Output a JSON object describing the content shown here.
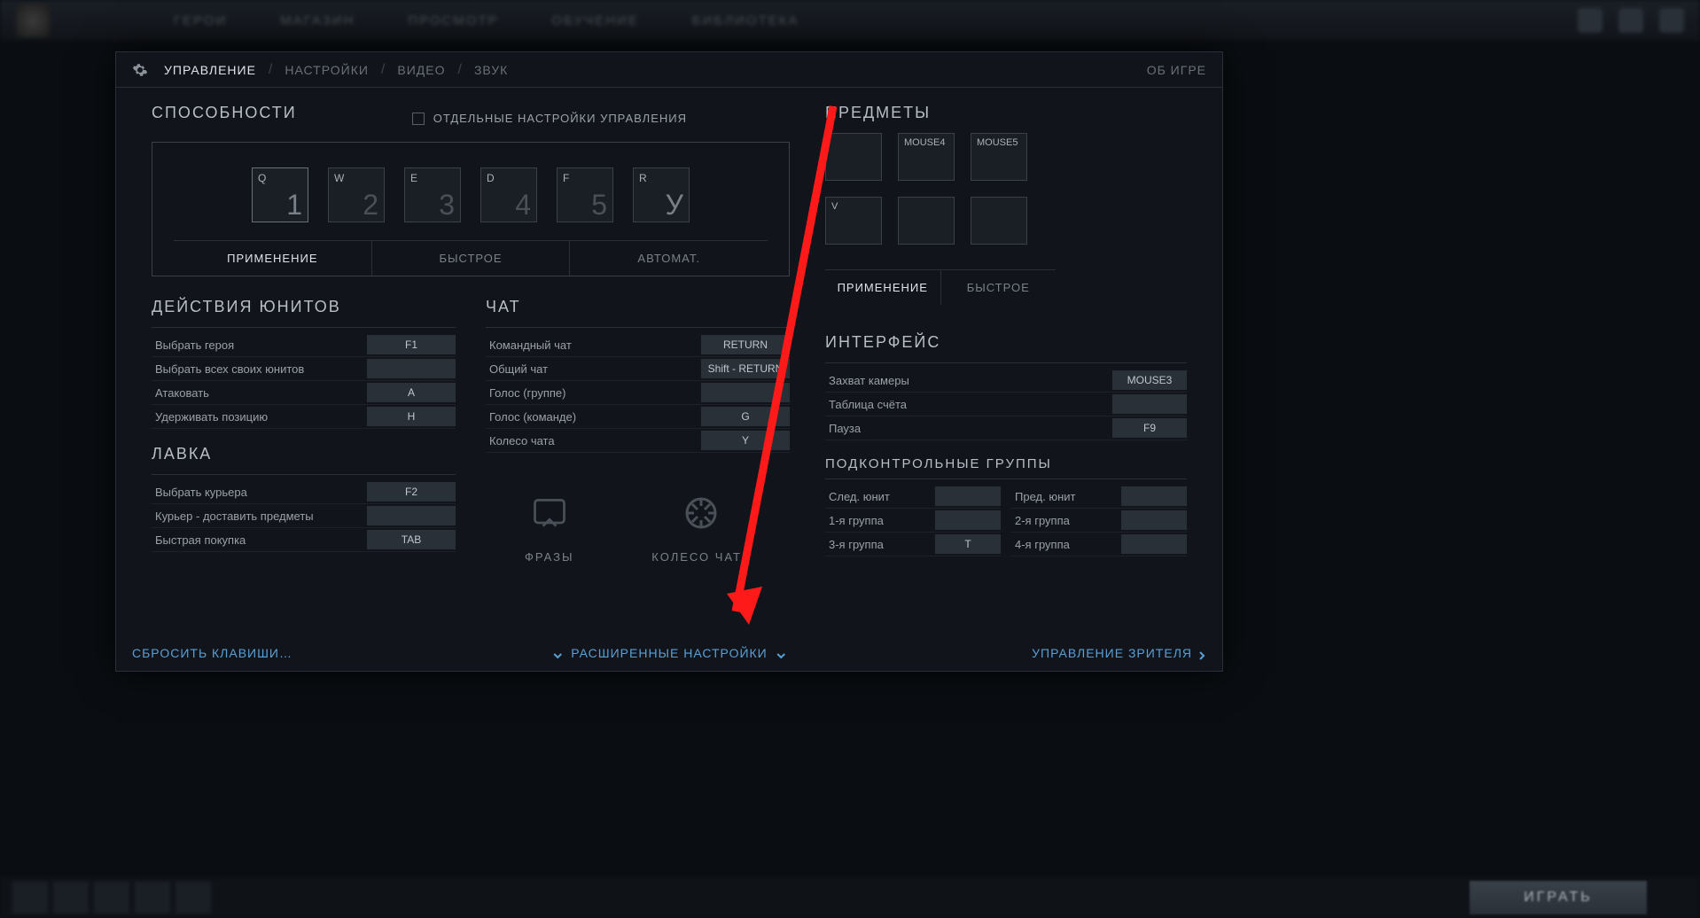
{
  "topnav": {
    "items": [
      "ГЕРОИ",
      "МАГАЗИН",
      "ПРОСМОТР",
      "ОБУЧЕНИЕ",
      "БИБЛИОТЕКА"
    ]
  },
  "tabs": {
    "controls": "УПРАВЛЕНИЕ",
    "settings": "НАСТРОЙКИ",
    "video": "ВИДЕО",
    "audio": "ЗВУК",
    "about": "ОБ ИГРЕ"
  },
  "abilities": {
    "title": "СПОСОБНОСТИ",
    "advanced_hotkeys": "ОТДЕЛЬНЫЕ НАСТРОЙКИ УПРАВЛЕНИЯ",
    "slots": [
      {
        "key": "Q",
        "num": "1"
      },
      {
        "key": "W",
        "num": "2"
      },
      {
        "key": "E",
        "num": "3"
      },
      {
        "key": "D",
        "num": "4"
      },
      {
        "key": "F",
        "num": "5"
      },
      {
        "key": "R",
        "num": "У"
      }
    ],
    "mode_cast": "ПРИМЕНЕНИЕ",
    "mode_quick": "БЫСТРОЕ",
    "mode_auto": "АВТОМАТ."
  },
  "unit_actions": {
    "title": "ДЕЙСТВИЯ ЮНИТОВ",
    "rows": [
      {
        "label": "Выбрать героя",
        "key": "F1"
      },
      {
        "label": "Выбрать всех своих юнитов",
        "key": ""
      },
      {
        "label": "Атаковать",
        "key": "A"
      },
      {
        "label": "Удерживать позицию",
        "key": "H"
      }
    ]
  },
  "shop": {
    "title": "ЛАВКА",
    "rows": [
      {
        "label": "Выбрать курьера",
        "key": "F2"
      },
      {
        "label": "Курьер - доставить предметы",
        "key": ""
      },
      {
        "label": "Быстрая покупка",
        "key": "TAB"
      }
    ]
  },
  "chat": {
    "title": "ЧАТ",
    "rows": [
      {
        "label": "Командный чат",
        "key": "RETURN"
      },
      {
        "label": "Общий чат",
        "key": "Shift - RETURN"
      },
      {
        "label": "Голос (группе)",
        "key": ""
      },
      {
        "label": "Голос (команде)",
        "key": "G"
      },
      {
        "label": "Колесо чата",
        "key": "Y"
      }
    ],
    "phrases": "ФРАЗЫ",
    "wheel": "КОЛЕСО ЧАТА"
  },
  "items": {
    "title": "ПРЕДМЕТЫ",
    "slots": [
      {
        "key": ""
      },
      {
        "key": "MOUSE4"
      },
      {
        "key": "MOUSE5"
      },
      {
        "key": "V"
      },
      {
        "key": ""
      },
      {
        "key": ""
      }
    ],
    "mode_cast": "ПРИМЕНЕНИЕ",
    "mode_quick": "БЫСТРОЕ"
  },
  "interface": {
    "title": "ИНТЕРФЕЙС",
    "rows": [
      {
        "label": "Захват камеры",
        "key": "MOUSE3"
      },
      {
        "label": "Таблица счёта",
        "key": ""
      },
      {
        "label": "Пауза",
        "key": "F9"
      }
    ]
  },
  "control_groups": {
    "title": "ПОДКОНТРОЛЬНЫЕ ГРУППЫ",
    "next": {
      "label": "След. юнит",
      "key": ""
    },
    "prev": {
      "label": "Пред. юнит",
      "key": ""
    },
    "g1": {
      "label": "1-я группа",
      "key": ""
    },
    "g2": {
      "label": "2-я группа",
      "key": ""
    },
    "g3": {
      "label": "3-я группа",
      "key": "T"
    },
    "g4": {
      "label": "4-я группа",
      "key": ""
    }
  },
  "footer": {
    "reset": "СБРОСИТЬ КЛАВИШИ…",
    "advanced": "РАСШИРЕННЫЕ НАСТРОЙКИ",
    "spectator": "УПРАВЛЕНИЕ ЗРИТЕЛЯ"
  },
  "play": "ИГРАТЬ"
}
